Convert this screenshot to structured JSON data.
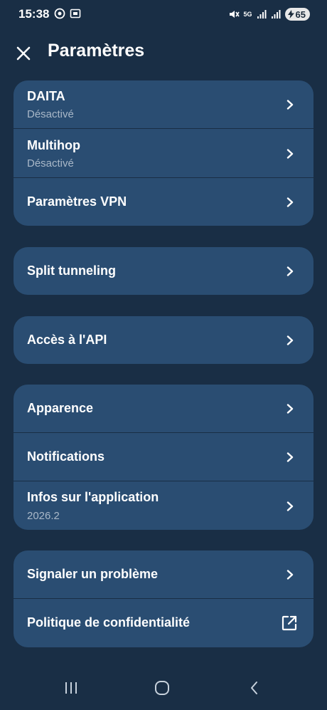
{
  "status": {
    "time": "15:38",
    "network": "5G",
    "battery": "65"
  },
  "header": {
    "title": "Paramètres"
  },
  "groups": [
    {
      "items": [
        {
          "label": "DAITA",
          "sub": "Désactivé"
        },
        {
          "label": "Multihop",
          "sub": "Désactivé"
        },
        {
          "label": "Paramètres VPN"
        }
      ]
    },
    {
      "items": [
        {
          "label": "Split tunneling"
        }
      ]
    },
    {
      "items": [
        {
          "label": "Accès à l'API"
        }
      ]
    },
    {
      "items": [
        {
          "label": "Apparence"
        },
        {
          "label": "Notifications"
        },
        {
          "label": "Infos sur l'application",
          "sub": "2026.2"
        }
      ]
    },
    {
      "items": [
        {
          "label": "Signaler un problème"
        },
        {
          "label": "Politique de confidentialité"
        }
      ]
    }
  ],
  "colors": {
    "background": "#192e45",
    "card": "#2a4d72",
    "subtext": "#a9b8c8"
  }
}
